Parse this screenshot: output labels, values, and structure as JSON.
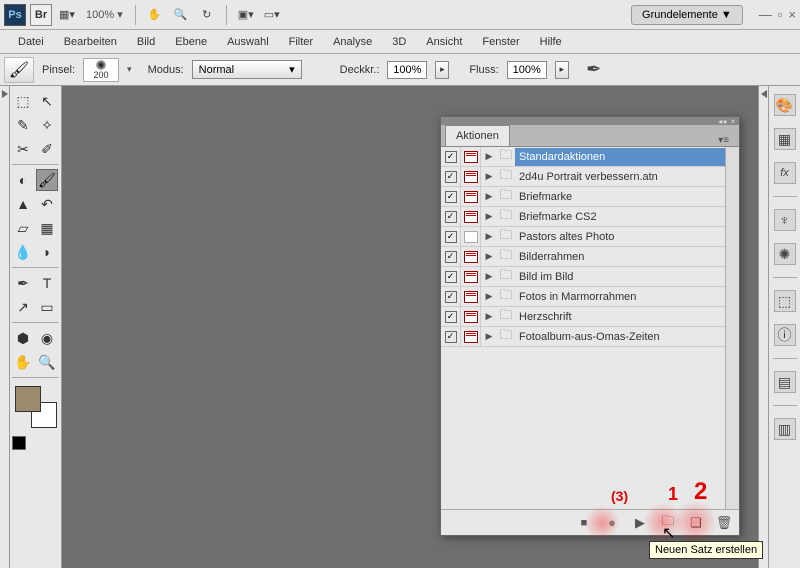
{
  "top": {
    "zoom": "100% ▾",
    "workspace": "Grundelemente ▼"
  },
  "menu": [
    "Datei",
    "Bearbeiten",
    "Bild",
    "Ebene",
    "Auswahl",
    "Filter",
    "Analyse",
    "3D",
    "Ansicht",
    "Fenster",
    "Hilfe"
  ],
  "options": {
    "brush_label": "Pinsel:",
    "brush_size": "200",
    "mode_label": "Modus:",
    "mode_value": "Normal",
    "opacity_label": "Deckkr.:",
    "opacity_value": "100%",
    "flow_label": "Fluss:",
    "flow_value": "100%"
  },
  "panel": {
    "tab": "Aktionen",
    "rows": [
      {
        "chk": true,
        "dlg": true,
        "name": "Standardaktionen",
        "selected": true
      },
      {
        "chk": true,
        "dlg": true,
        "name": "2d4u Portrait verbessern.atn"
      },
      {
        "chk": true,
        "dlg": true,
        "name": "Briefmarke"
      },
      {
        "chk": true,
        "dlg": true,
        "name": "Briefmarke CS2"
      },
      {
        "chk": true,
        "dlg": false,
        "name": "Pastors altes Photo"
      },
      {
        "chk": true,
        "dlg": true,
        "name": "Bilderrahmen"
      },
      {
        "chk": true,
        "dlg": true,
        "name": "Bild im Bild"
      },
      {
        "chk": true,
        "dlg": true,
        "name": "Fotos in Marmorrahmen"
      },
      {
        "chk": true,
        "dlg": true,
        "name": "Herzschrift"
      },
      {
        "chk": true,
        "dlg": true,
        "name": "Fotoalbum-aus-Omas-Zeiten"
      }
    ]
  },
  "annotations": {
    "three": "(3)",
    "one": "1",
    "two": "2"
  },
  "tooltip": "Neuen Satz erstellen"
}
